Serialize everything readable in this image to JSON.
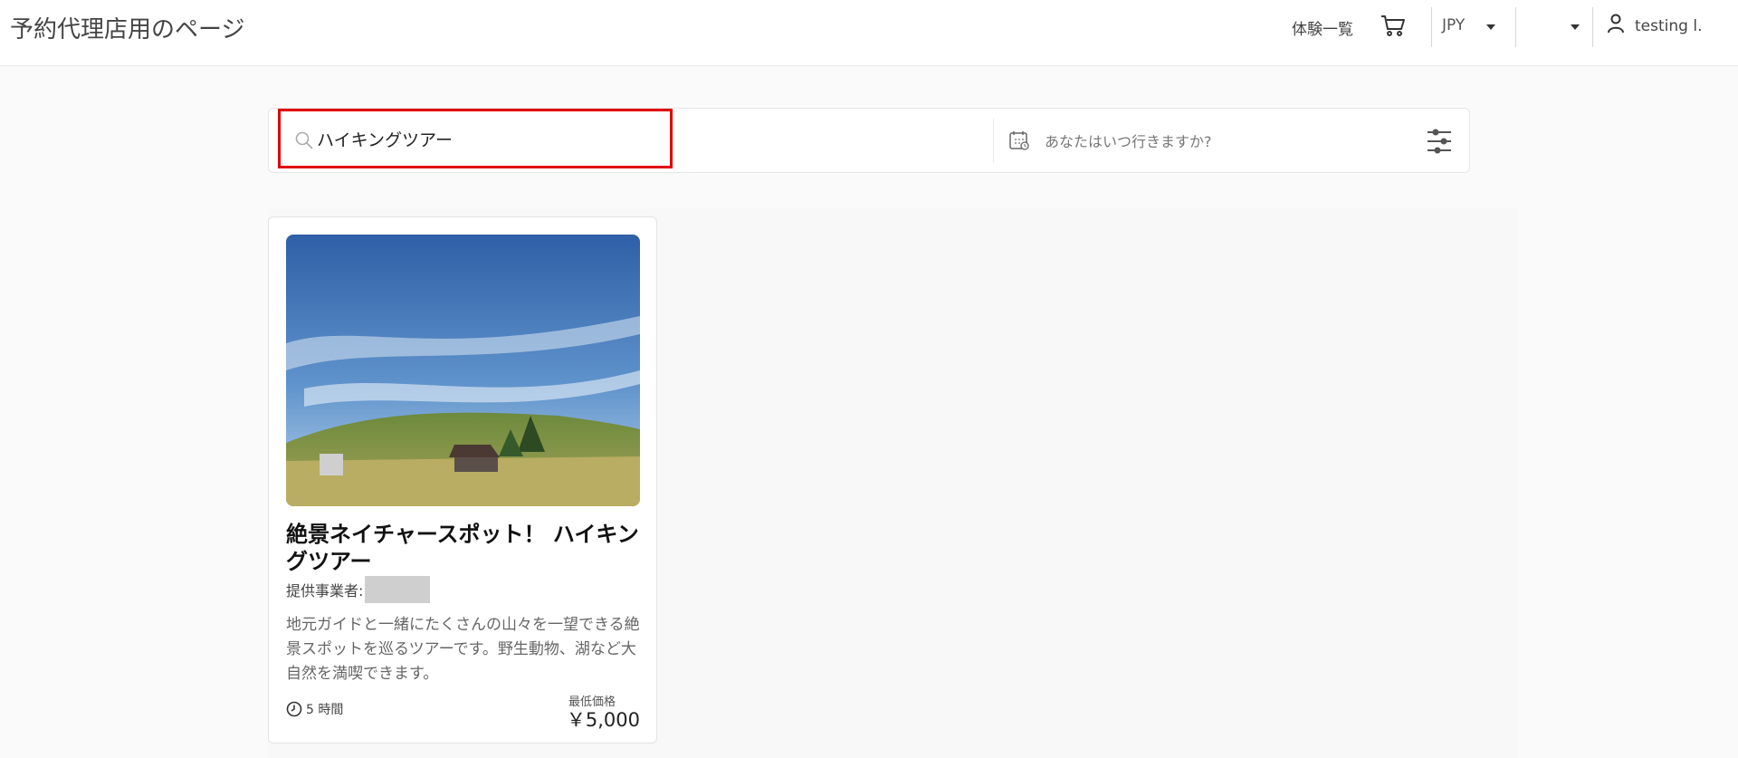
{
  "header": {
    "site_title": "予約代理店用のページ",
    "nav_experiences": "体験一覧",
    "currency": "JPY",
    "language": "",
    "user_name": "testing l."
  },
  "search": {
    "keyword_value": "ハイキングツアー",
    "date_placeholder": "あなたはいつ行きますか?"
  },
  "results": [
    {
      "title": "絶景ネイチャースポット！ ハイキングツアー",
      "provider_label": "提供事業者:",
      "description": "地元ガイドと一緒にたくさんの山々を一望できる絶景スポットを巡るツアーです。野生動物、湖など大自然を満喫できます。",
      "duration": "5 時間",
      "price_label": "最低価格",
      "price": "￥5,000"
    }
  ],
  "colors": {
    "highlight_border": "#e00000",
    "text_primary": "#111111"
  }
}
